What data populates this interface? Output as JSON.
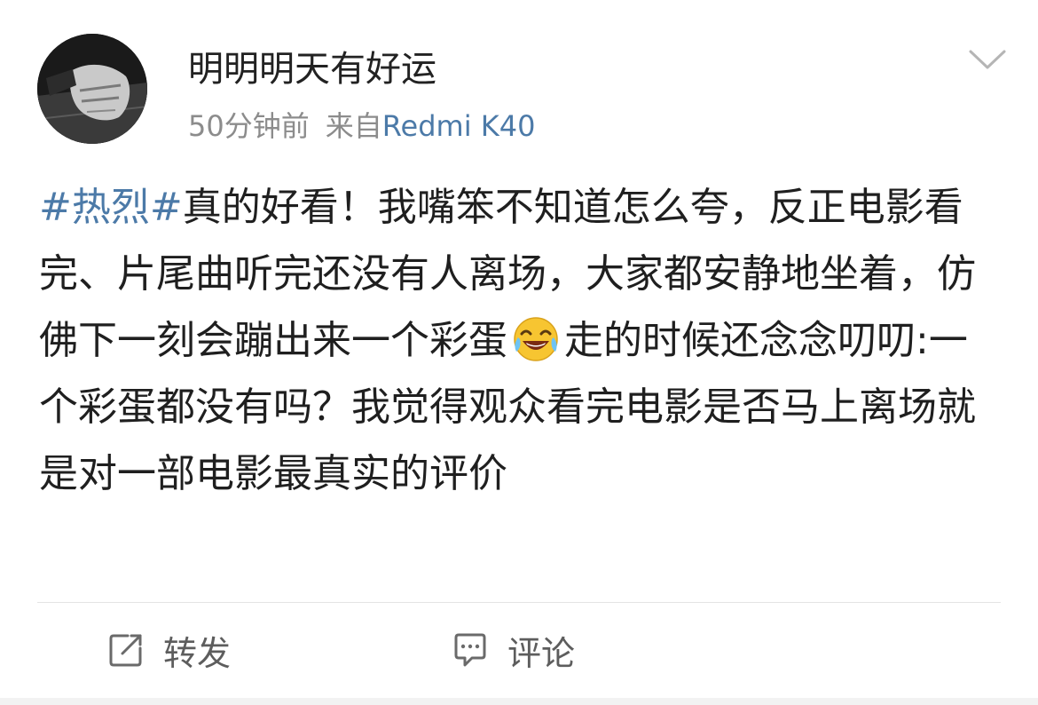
{
  "post": {
    "username": "明明明天有好运",
    "time": "50分钟前",
    "source_prefix": "来自",
    "device": "Redmi K40",
    "topic": "#热烈#",
    "text_before_emoji": "真的好看！我嘴笨不知道怎么夸，反正电影看完、片尾曲听完还没有人离场，大家都安静地坐着，仿佛下一刻会蹦出来一个彩蛋",
    "emoji": "laughing-tears-emoji",
    "text_after_emoji": "走的时候还念念叨叨:一个彩蛋都没有吗？我觉得观众看完电影是否马上离场就是对一部电影最真实的评价"
  },
  "actions": {
    "repost_label": "转发",
    "comment_label": "评论"
  },
  "icons": {
    "menu": "chevron-down-icon",
    "repost": "repost-icon",
    "comment": "comment-icon"
  },
  "colors": {
    "link": "#4c7aa8",
    "text": "#1f1f1f",
    "meta": "#8c8c8c"
  }
}
